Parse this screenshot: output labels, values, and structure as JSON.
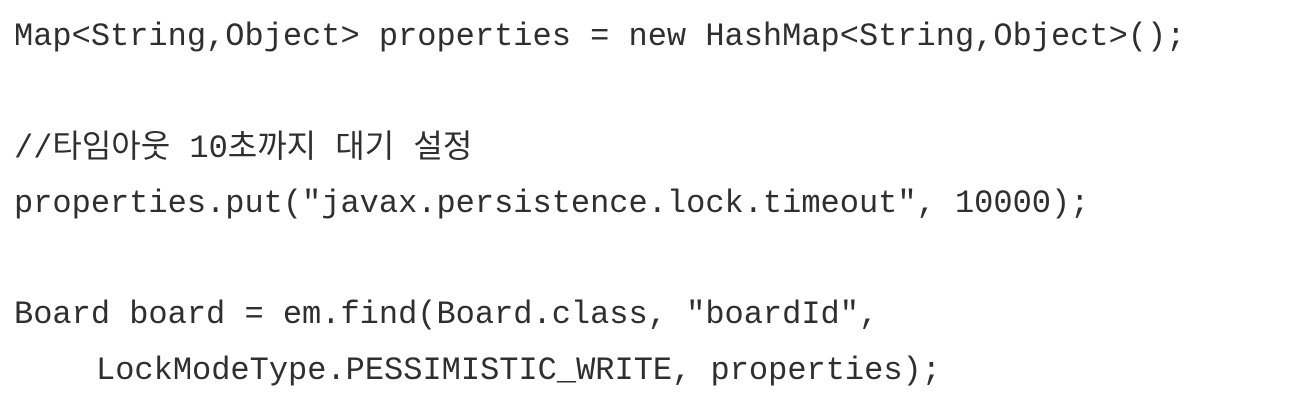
{
  "code": {
    "lines": [
      "Map<String,Object> properties = new HashMap<String,Object>();",
      "//타임아웃 10초까지 대기 설정",
      "properties.put(\"javax.persistence.lock.timeout\", 10000);",
      "Board board = em.find(Board.class, \"boardId\",",
      "LockModeType.PESSIMISTIC_WRITE, properties);"
    ]
  }
}
